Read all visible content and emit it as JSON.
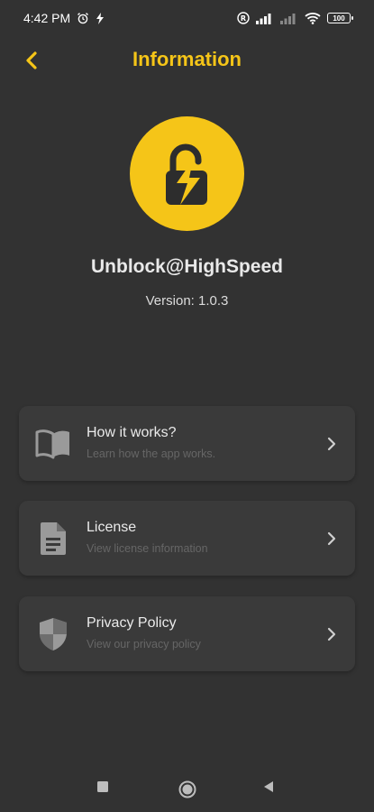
{
  "status_bar": {
    "time": "4:42 PM",
    "battery": "100"
  },
  "header": {
    "title": "Information"
  },
  "app": {
    "name": "Unblock@HighSpeed",
    "version": "Version: 1.0.3"
  },
  "menu": [
    {
      "title": "How it works?",
      "subtitle": "Learn how the app works.",
      "icon": "book-icon"
    },
    {
      "title": "License",
      "subtitle": "View license information",
      "icon": "document-icon"
    },
    {
      "title": "Privacy Policy",
      "subtitle": "View our privacy policy",
      "icon": "shield-icon"
    }
  ],
  "colors": {
    "accent": "#f5c518",
    "background": "#323232",
    "card": "#3a3a3a"
  }
}
